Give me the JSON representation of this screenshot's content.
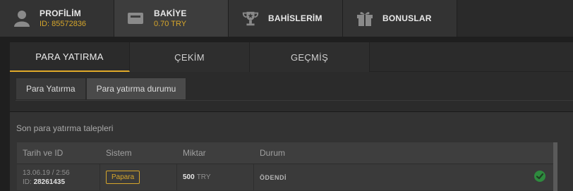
{
  "nav": {
    "profile": {
      "title": "PROFİLİM",
      "sub": "ID: 85572836",
      "icon": "user-icon"
    },
    "balance": {
      "title": "BAKİYE",
      "sub": "0.70 TRY",
      "icon": "wallet-icon"
    },
    "bets": {
      "title": "BAHİSLERİM",
      "icon": "trophy-icon"
    },
    "bonus": {
      "title": "BONUSLAR",
      "icon": "gift-icon"
    }
  },
  "tabs": [
    "PARA YATIRMA",
    "ÇEKİM",
    "GEÇMİŞ"
  ],
  "subtabs": [
    "Para Yatırma",
    "Para yatırma durumu"
  ],
  "section_title": "Son para yatırma talepleri",
  "table": {
    "headers": [
      "Tarih ve ID",
      "Sistem",
      "Miktar",
      "Durum"
    ],
    "rows": [
      {
        "date": "13.06.19 / 2:56",
        "id_prefix": "ID:",
        "id": "28261435",
        "system": "Papara",
        "amount": "500",
        "currency": "TRY",
        "status": "ÖDENDİ",
        "status_icon": "check-circle-icon"
      }
    ]
  },
  "colors": {
    "accent": "#d6a62b",
    "success": "#2e8b3e"
  }
}
